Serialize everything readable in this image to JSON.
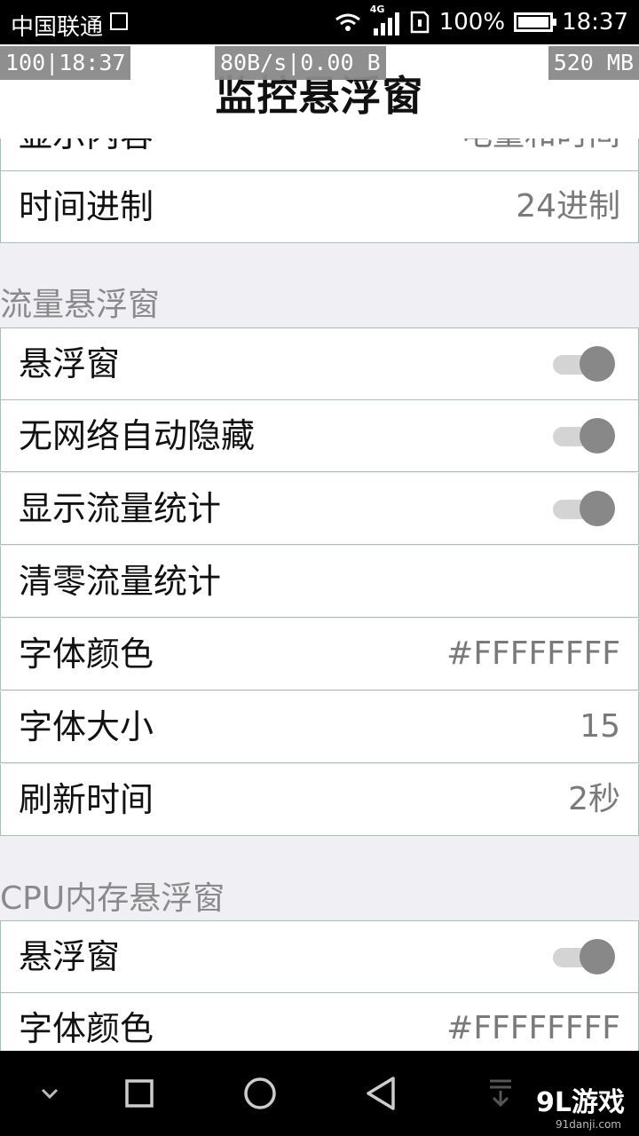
{
  "status_bar": {
    "carrier": "中国联通",
    "network_type": "4G",
    "battery": "100%",
    "time": "18:37"
  },
  "overlays": {
    "battery_time": "100|18:37",
    "traffic": "80B/s|0.00 B",
    "memory": "520 MB"
  },
  "header": {
    "title": "监控悬浮窗"
  },
  "top_section": {
    "rows": [
      {
        "label": "显示内容",
        "value": "电量和时间"
      },
      {
        "label": "时间进制",
        "value": "24进制"
      }
    ]
  },
  "traffic_section": {
    "title": "流量悬浮窗",
    "rows": [
      {
        "label": "悬浮窗",
        "toggle": true
      },
      {
        "label": "无网络自动隐藏",
        "toggle": true
      },
      {
        "label": "显示流量统计",
        "toggle": true
      },
      {
        "label": "清零流量统计"
      },
      {
        "label": "字体颜色",
        "value": "#FFFFFFFF"
      },
      {
        "label": "字体大小",
        "value": "15"
      },
      {
        "label": "刷新时间",
        "value": "2秒"
      }
    ]
  },
  "cpu_section": {
    "title": "CPU内存悬浮窗",
    "rows": [
      {
        "label": "悬浮窗",
        "toggle": true
      },
      {
        "label": "字体颜色",
        "value": "#FFFFFFFF"
      }
    ]
  },
  "nav_bar": {
    "icons": [
      "chevron-down-icon",
      "recents-icon",
      "home-icon",
      "back-icon",
      "notification-pull-icon"
    ]
  },
  "watermark": {
    "logo": "9L游戏",
    "site": "91danji.com"
  },
  "colors": {
    "row_border": "#9fc4b5",
    "background": "#efeff4",
    "toggle_thumb": "#888888"
  }
}
